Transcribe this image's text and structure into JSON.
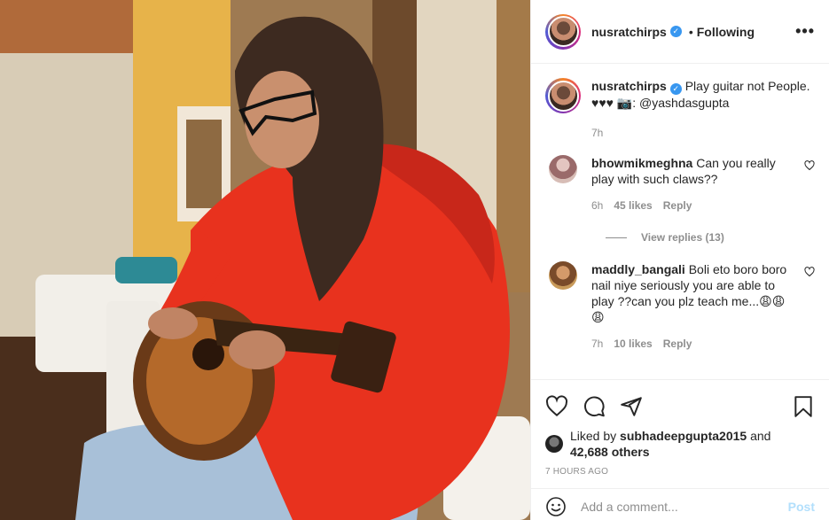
{
  "header": {
    "username": "nusratchirps",
    "separator": "•",
    "follow_status": "Following",
    "more_label": "•••"
  },
  "caption": {
    "username": "nusratchirps",
    "text": "Play guitar not People.",
    "line2": "♥♥♥ 📷: @yashdasgupta",
    "time": "7h"
  },
  "comments": [
    {
      "username": "bhowmikmeghna",
      "text": "Can you really play with such claws??",
      "time": "6h",
      "likes": "45 likes",
      "reply": "Reply",
      "view_replies": "View replies (13)"
    },
    {
      "username": "maddly_bangali",
      "text": "Boli eto boro boro nail niye seriously you are able to play ??can you plz teach me...😩😩😩",
      "time": "7h",
      "likes": "10 likes",
      "reply": "Reply"
    }
  ],
  "actions": {
    "liked_prefix": "Liked by",
    "liked_user": "subhadeepgupta2015",
    "liked_and": "and",
    "liked_others": "42,688 others",
    "time_ago": "7 HOURS AGO"
  },
  "add_comment": {
    "placeholder": "Add a comment...",
    "post_label": "Post"
  },
  "colors": {
    "accent_blue": "#0095f6",
    "verified_blue": "#3897f0",
    "muted": "#8e8e8e",
    "hoodie_red": "#e8321e"
  },
  "icons": [
    "more-icon",
    "heart-icon",
    "comment-icon",
    "share-icon",
    "bookmark-icon",
    "emoji-icon",
    "verified-icon"
  ]
}
